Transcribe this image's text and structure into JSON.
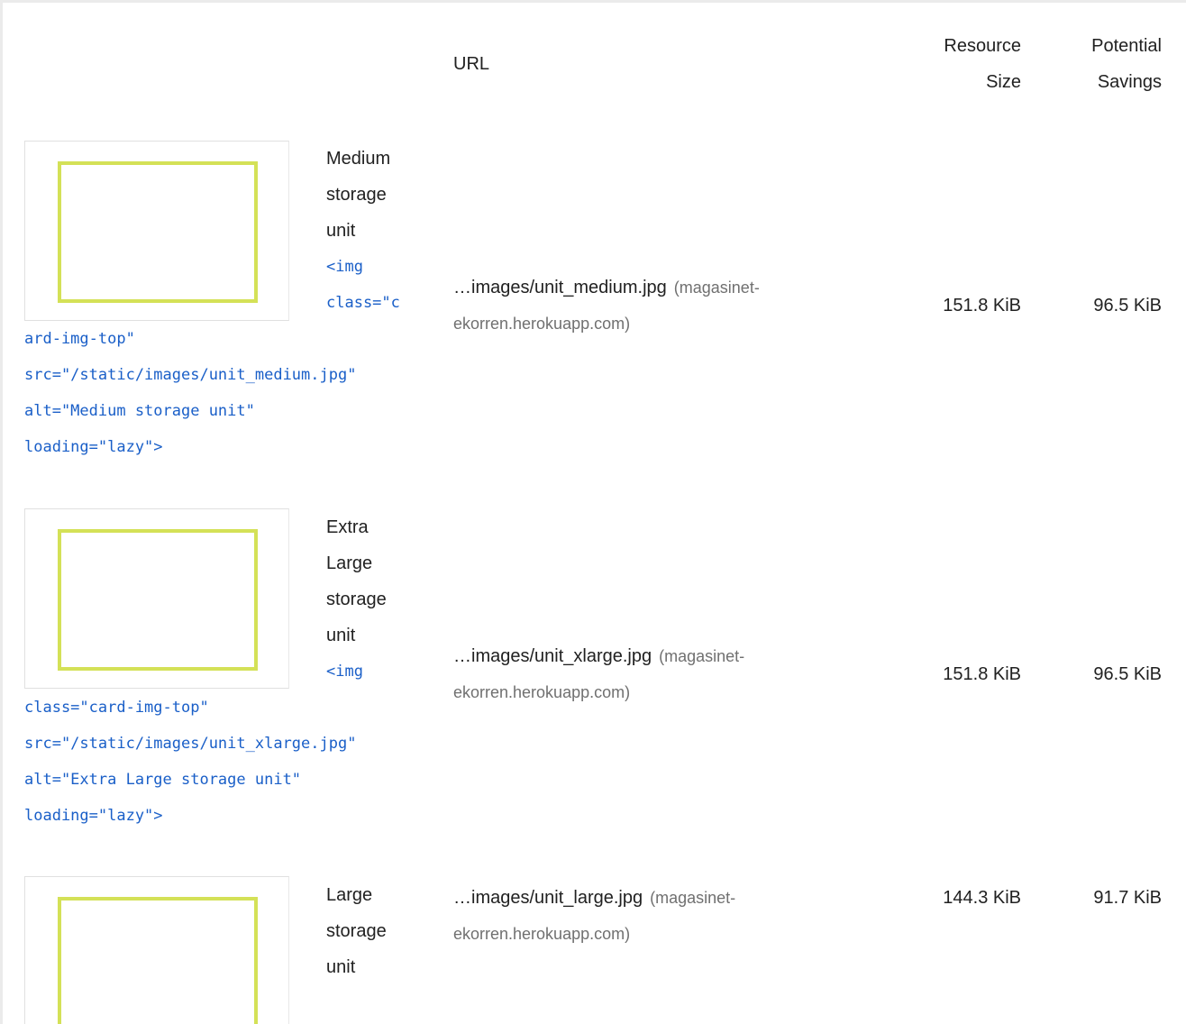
{
  "table": {
    "headers": {
      "url": "URL",
      "resource_size_line1": "Resource",
      "resource_size_line2": "Size",
      "potential_savings_line1": "Potential",
      "potential_savings_line2": "Savings"
    },
    "rows": [
      {
        "label_lines": [
          "Medium",
          "storage",
          "unit"
        ],
        "snippet_start": "<img",
        "snippet_line2": "class=\"c",
        "snippet_rest": [
          "ard-img-top\"",
          "src=\"/static/images/unit_medium.jpg\"",
          "alt=\"Medium storage unit\"",
          "loading=\"lazy\">"
        ],
        "url": "…images/unit_medium.jpg",
        "origin_line1": "(magasinet-",
        "origin_line2": "ekorren.herokuapp.com)",
        "resource_size": "151.8 KiB",
        "potential_savings": "96.5 KiB"
      },
      {
        "label_lines": [
          "Extra",
          "Large",
          "storage",
          "unit"
        ],
        "snippet_start": "<img",
        "snippet_rest": [
          "class=\"card-img-top\"",
          "src=\"/static/images/unit_xlarge.jpg\"",
          "alt=\"Extra Large storage unit\"",
          "loading=\"lazy\">"
        ],
        "url": "…images/unit_xlarge.jpg",
        "origin_line1": "(magasinet-",
        "origin_line2": "ekorren.herokuapp.com)",
        "resource_size": "151.8 KiB",
        "potential_savings": "96.5 KiB"
      },
      {
        "label_lines": [
          "Large",
          "storage",
          "unit"
        ],
        "url": "…images/unit_large.jpg",
        "origin_line1": "(magasinet-",
        "origin_line2": "ekorren.herokuapp.com)",
        "resource_size": "144.3 KiB",
        "potential_savings": "91.7 KiB"
      }
    ]
  },
  "colors": {
    "thumbnail_frame": "#d4e157",
    "snippet_text": "#1a5fc8",
    "origin_text": "#707070"
  }
}
